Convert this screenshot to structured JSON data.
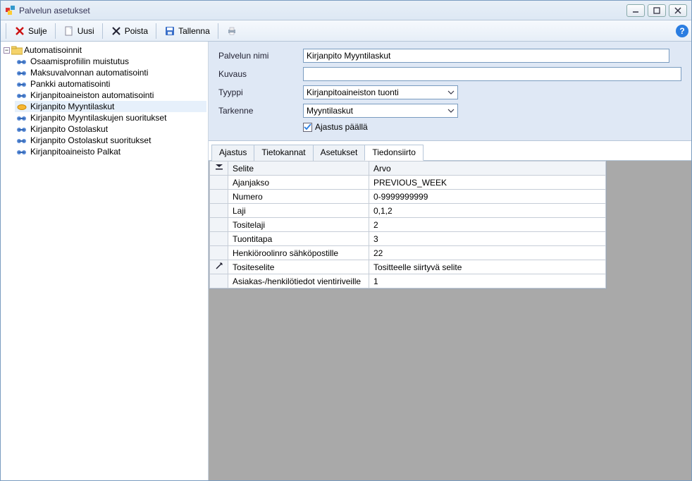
{
  "window": {
    "title": "Palvelun asetukset"
  },
  "toolbar": {
    "close_label": "Sulje",
    "new_label": "Uusi",
    "delete_label": "Poista",
    "save_label": "Tallenna"
  },
  "tree": {
    "root_label": "Automatisoinnit",
    "items": [
      {
        "label": "Osaamisprofiilin muistutus"
      },
      {
        "label": "Maksuvalvonnan automatisointi"
      },
      {
        "label": "Pankki automatisointi"
      },
      {
        "label": "Kirjanpitoaineiston automatisointi"
      },
      {
        "label": "Kirjanpito Myyntilaskut"
      },
      {
        "label": "Kirjanpito Myyntilaskujen suoritukset"
      },
      {
        "label": "Kirjanpito Ostolaskut"
      },
      {
        "label": "Kirjanpito Ostolaskut suoritukset"
      },
      {
        "label": "Kirjanpitoaineisto Palkat"
      }
    ],
    "selected_index": 4
  },
  "form": {
    "name_label": "Palvelun nimi",
    "name_value": "Kirjanpito Myyntilaskut",
    "desc_label": "Kuvaus",
    "desc_value": "",
    "type_label": "Tyyppi",
    "type_value": "Kirjanpitoaineiston tuonti",
    "sub_label": "Tarkenne",
    "sub_value": "Myyntilaskut",
    "scheduler_label": "Ajastus päällä",
    "scheduler_checked": true
  },
  "tabs": {
    "items": [
      "Ajastus",
      "Tietokannat",
      "Asetukset",
      "Tiedonsiirto"
    ],
    "active_index": 3
  },
  "grid": {
    "col_selite": "Selite",
    "col_arvo": "Arvo",
    "rows": [
      {
        "selite": "Ajanjakso",
        "arvo": "PREVIOUS_WEEK"
      },
      {
        "selite": "Numero",
        "arvo": "0-9999999999"
      },
      {
        "selite": "Laji",
        "arvo": "0,1,2"
      },
      {
        "selite": "Tositelaji",
        "arvo": "2"
      },
      {
        "selite": "Tuontitapa",
        "arvo": "3"
      },
      {
        "selite": "Henkiöroolinro sähköpostille",
        "arvo": "22"
      },
      {
        "selite": "Tositeselite",
        "arvo": "Tositteelle siirtyvä selite"
      },
      {
        "selite": "Asiakas-/henkilötiedot vientiriveille",
        "arvo": "1"
      }
    ],
    "edit_row_index": 6
  }
}
